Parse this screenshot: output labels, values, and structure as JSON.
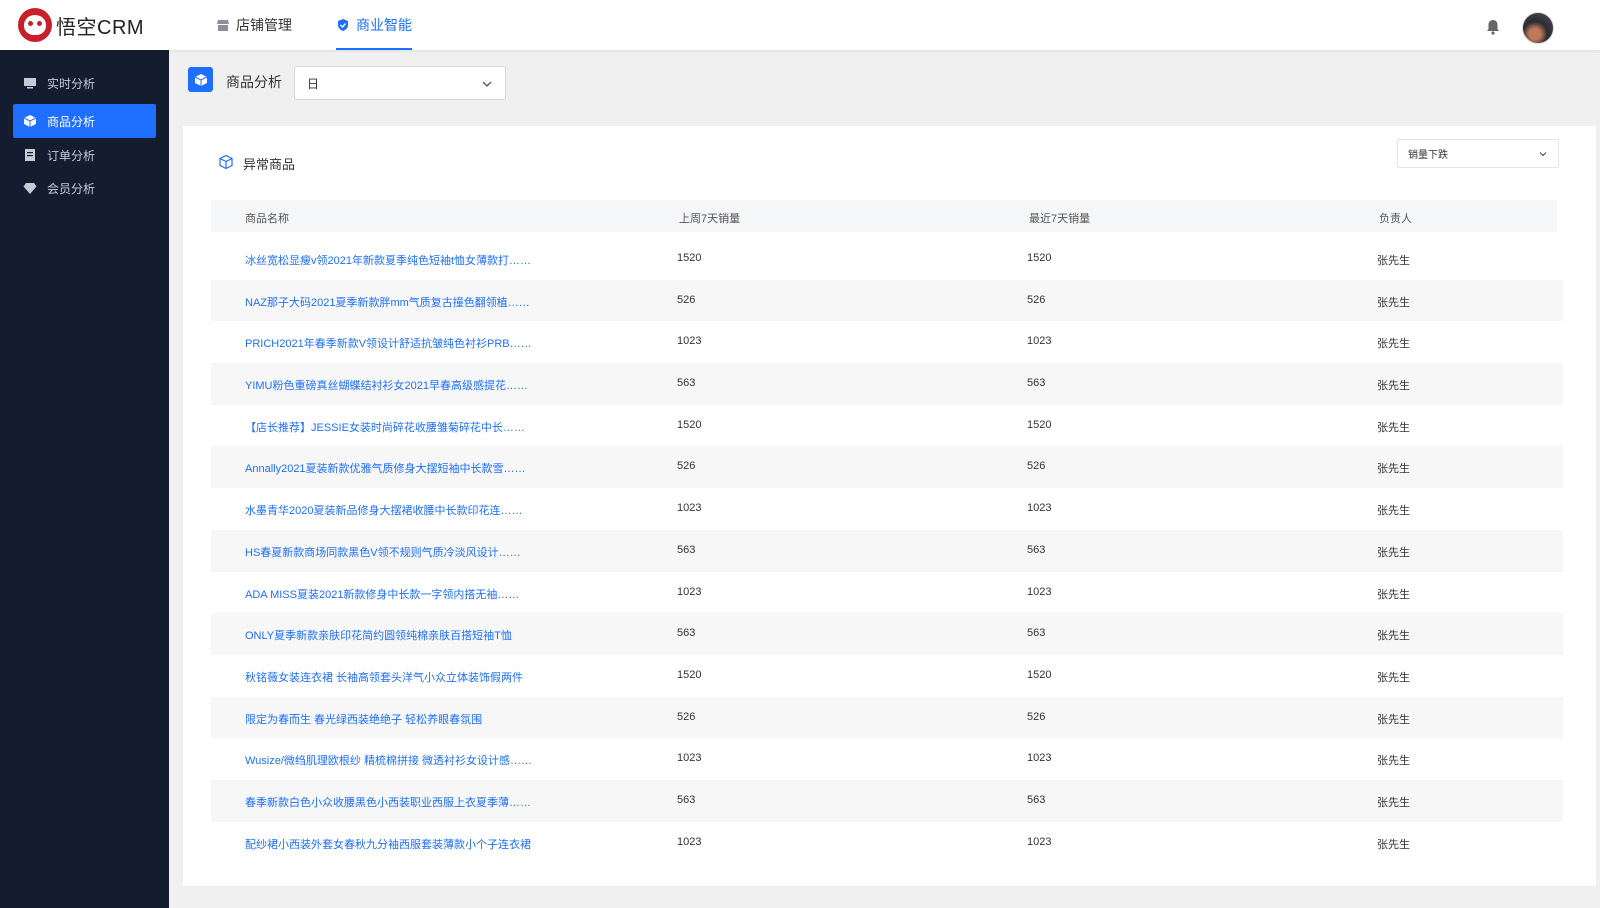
{
  "app": {
    "logo_text": "悟空CRM"
  },
  "topnav": [
    {
      "label": "店铺管理",
      "icon": "store-icon"
    },
    {
      "label": "商业智能",
      "icon": "shield-check-icon",
      "active": true
    }
  ],
  "sidebar": {
    "items": [
      {
        "label": "实时分析",
        "icon": "monitor-icon"
      },
      {
        "label": "商品分析",
        "icon": "cube-icon",
        "active": true
      },
      {
        "label": "订单分析",
        "icon": "document-icon"
      },
      {
        "label": "会员分析",
        "icon": "diamond-icon"
      }
    ]
  },
  "header": {
    "title": "商品分析",
    "period_value": "日"
  },
  "card": {
    "title": "异常商品",
    "sort_value": "销量下跌",
    "columns": [
      "商品名称",
      "上周7天销量",
      "最近7天销量",
      "负责人"
    ],
    "rows": [
      {
        "name": "冰丝宽松显瘦v领2021年新款夏季纯色短袖t恤女薄款打……",
        "last_week": "1520",
        "recent": "1520",
        "owner": "张先生"
      },
      {
        "name": "NAZ那子大码2021夏季新款胖mm气质复古撞色翻领植……",
        "last_week": "526",
        "recent": "526",
        "owner": "张先生"
      },
      {
        "name": "PRICH2021年春季新款V领设计舒适抗皱纯色衬衫PRB……",
        "last_week": "1023",
        "recent": "1023",
        "owner": "张先生"
      },
      {
        "name": "YIMU粉色重磅真丝蝴蝶结衬衫女2021早春高级感提花……",
        "last_week": "563",
        "recent": "563",
        "owner": "张先生"
      },
      {
        "name": "【店长推荐】JESSIE女装时尚碎花收腰雏菊碎花中长……",
        "last_week": "1520",
        "recent": "1520",
        "owner": "张先生"
      },
      {
        "name": "Annally2021夏装新款优雅气质修身大摆短袖中长款雪……",
        "last_week": "526",
        "recent": "526",
        "owner": "张先生"
      },
      {
        "name": "水墨青华2020夏装新品修身大摆裙收腰中长款印花连……",
        "last_week": "1023",
        "recent": "1023",
        "owner": "张先生"
      },
      {
        "name": "HS春夏新款商场同款黑色V领不规则气质冷淡风设计……",
        "last_week": "563",
        "recent": "563",
        "owner": "张先生"
      },
      {
        "name": "ADA MISS夏装2021新款修身中长款一字领内搭无袖……",
        "last_week": "1023",
        "recent": "1023",
        "owner": "张先生"
      },
      {
        "name": "ONLY夏季新款亲肤印花简约圆领纯棉亲肤百搭短袖T恤",
        "last_week": "563",
        "recent": "563",
        "owner": "张先生"
      },
      {
        "name": "秋铭薇女装连衣裙 长袖高领套头洋气小众立体装饰假两件",
        "last_week": "1520",
        "recent": "1520",
        "owner": "张先生"
      },
      {
        "name": "限定为春而生 春光绿西装绝绝子 轻松养眼春氛围",
        "last_week": "526",
        "recent": "526",
        "owner": "张先生"
      },
      {
        "name": "Wusize/微绉肌理欧根纱 精梳棉拼接 微透衬衫女设计感……",
        "last_week": "1023",
        "recent": "1023",
        "owner": "张先生"
      },
      {
        "name": "春季新款白色小众收腰黑色小西装职业西服上衣夏季薄……",
        "last_week": "563",
        "recent": "563",
        "owner": "张先生"
      },
      {
        "name": "配纱裙小西装外套女春秋九分袖西服套装薄款小个子连衣裙",
        "last_week": "1023",
        "recent": "1023",
        "owner": "张先生"
      }
    ]
  },
  "colors": {
    "accent": "#1e6fff",
    "sidebar_bg": "#141c30",
    "page_bg": "#f0f0f0"
  }
}
